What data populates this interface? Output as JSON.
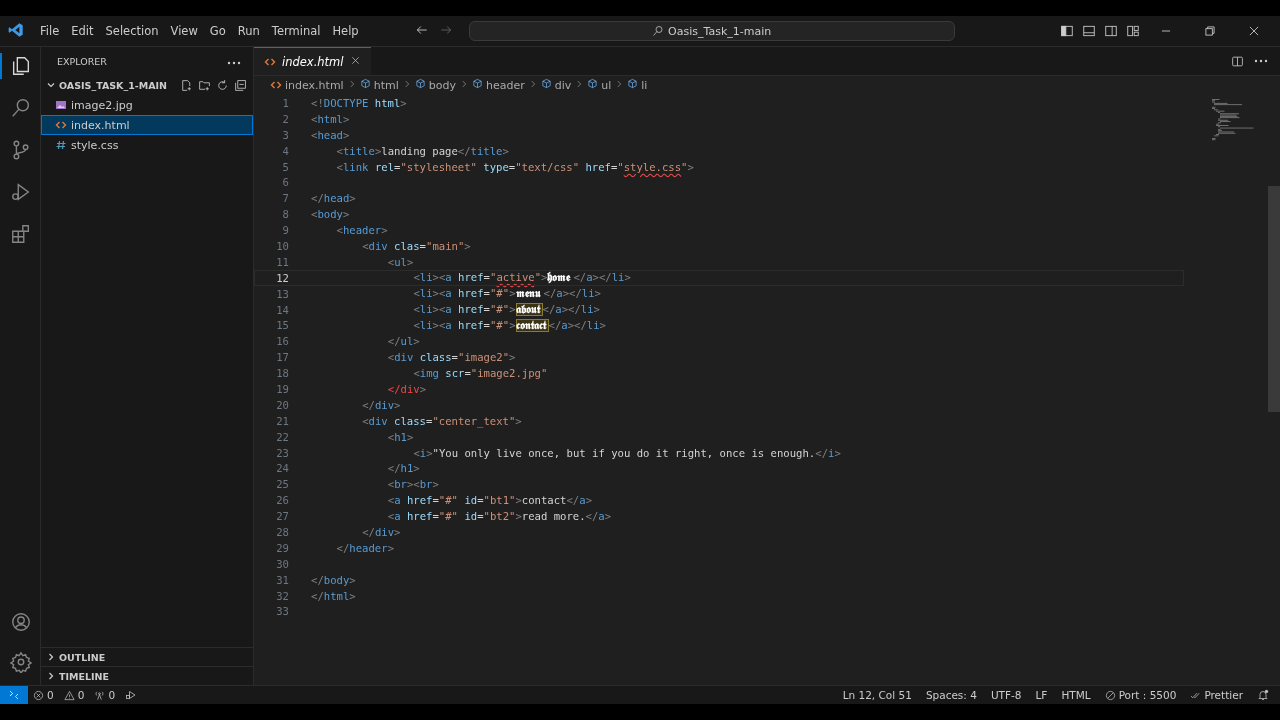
{
  "title_bar": {
    "menu": [
      "File",
      "Edit",
      "Selection",
      "View",
      "Go",
      "Run",
      "Terminal",
      "Help"
    ],
    "command_center": "Oasis_Task_1-main"
  },
  "activity_bar": {
    "items": [
      {
        "kind": "explorer",
        "selected": true
      },
      {
        "kind": "search",
        "selected": false
      },
      {
        "kind": "source-control",
        "selected": false
      },
      {
        "kind": "run-debug",
        "selected": false
      },
      {
        "kind": "extensions",
        "selected": false
      }
    ],
    "bottom": [
      {
        "kind": "account"
      },
      {
        "kind": "settings"
      }
    ]
  },
  "sidebar": {
    "title": "EXPLORER",
    "folder": {
      "name": "OASIS_TASK_1-MAIN",
      "expanded": true,
      "files": [
        {
          "name": "image2.jpg",
          "kind": "image",
          "selected": false
        },
        {
          "name": "index.html",
          "kind": "html",
          "selected": true
        },
        {
          "name": "style.css",
          "kind": "css",
          "selected": false
        }
      ]
    },
    "sections": [
      {
        "name": "OUTLINE",
        "expanded": false
      },
      {
        "name": "TIMELINE",
        "expanded": false
      }
    ]
  },
  "editor": {
    "tabs": [
      {
        "label": "index.html",
        "kind": "html",
        "selected": true
      }
    ],
    "breadcrumbs": [
      {
        "label": "index.html",
        "kind": "file"
      },
      {
        "label": "html",
        "kind": "element"
      },
      {
        "label": "body",
        "kind": "element"
      },
      {
        "label": "header",
        "kind": "element"
      },
      {
        "label": "div",
        "kind": "element"
      },
      {
        "label": "ul",
        "kind": "element"
      },
      {
        "label": "li",
        "kind": "element"
      }
    ],
    "lines": [
      {
        "number": "1",
        "current": false,
        "tokens": [
          {
            "kind": "punct",
            "text": "<!"
          },
          {
            "kind": "tag",
            "text": "DOCTYPE"
          },
          {
            "kind": "attr",
            "text": " html"
          },
          {
            "kind": "punct",
            "text": ">"
          }
        ]
      },
      {
        "number": "2",
        "current": false,
        "tokens": [
          {
            "kind": "punct",
            "text": "<"
          },
          {
            "kind": "tag",
            "text": "html"
          },
          {
            "kind": "punct",
            "text": ">"
          }
        ]
      },
      {
        "number": "3",
        "current": false,
        "tokens": [
          {
            "kind": "punct",
            "text": "<"
          },
          {
            "kind": "tag",
            "text": "head"
          },
          {
            "kind": "punct",
            "text": ">"
          }
        ],
        "children": [
          {
            "number": "4",
            "current": false,
            "tokens": [
              {
                "kind": "punct",
                "text": "<"
              },
              {
                "kind": "tag",
                "text": "title"
              },
              {
                "kind": "punct",
                "text": ">"
              },
              {
                "kind": "plain",
                "text": "landing page"
              },
              {
                "kind": "punct",
                "text": "</"
              },
              {
                "kind": "tag",
                "text": "title"
              },
              {
                "kind": "punct",
                "text": ">"
              }
            ]
          },
          {
            "number": "5",
            "current": false,
            "tokens": [
              {
                "kind": "punct",
                "text": "<"
              },
              {
                "kind": "tag",
                "text": "link"
              },
              {
                "kind": "attr",
                "text": " rel"
              },
              {
                "kind": "plain",
                "text": "="
              },
              {
                "kind": "str",
                "text": "\"stylesheet\""
              },
              {
                "kind": "attr",
                "text": " type"
              },
              {
                "kind": "plain",
                "text": "="
              },
              {
                "kind": "str",
                "text": "\"text/css\""
              },
              {
                "kind": "attr",
                "text": " href"
              },
              {
                "kind": "plain",
                "text": "="
              },
              {
                "kind": "str",
                "text": "\""
              },
              {
                "kind": "str",
                "text": "style.css",
                "squiggle": true
              },
              {
                "kind": "str",
                "text": "\""
              },
              {
                "kind": "punct",
                "text": ">"
              }
            ]
          },
          {
            "number": "6",
            "current": false
          }
        ]
      },
      {
        "number": "7",
        "current": false,
        "tokens": [
          {
            "kind": "punct",
            "text": "</"
          },
          {
            "kind": "tag",
            "text": "head"
          },
          {
            "kind": "punct",
            "text": ">"
          }
        ]
      },
      {
        "number": "8",
        "current": false,
        "tokens": [
          {
            "kind": "punct",
            "text": "<"
          },
          {
            "kind": "tag",
            "text": "body"
          },
          {
            "kind": "punct",
            "text": ">"
          }
        ],
        "children": [
          {
            "number": "9",
            "current": false,
            "tokens": [
              {
                "kind": "punct",
                "text": "<"
              },
              {
                "kind": "tag",
                "text": "header"
              },
              {
                "kind": "punct",
                "text": ">"
              }
            ],
            "children": [
              {
                "number": "10",
                "current": false,
                "tokens": [
                  {
                    "kind": "punct",
                    "text": "<"
                  },
                  {
                    "kind": "tag",
                    "text": "div"
                  },
                  {
                    "kind": "attr",
                    "text": " clas"
                  },
                  {
                    "kind": "plain",
                    "text": "="
                  },
                  {
                    "kind": "str",
                    "text": "\"main\""
                  },
                  {
                    "kind": "punct",
                    "text": ">"
                  }
                ],
                "children": [
                  {
                    "number": "11",
                    "current": false,
                    "tokens": [
                      {
                        "kind": "punct",
                        "text": "<"
                      },
                      {
                        "kind": "tag",
                        "text": "ul"
                      },
                      {
                        "kind": "punct",
                        "text": ">"
                      }
                    ],
                    "children": [
                      {
                        "number": "12",
                        "current": true,
                        "tokens": [
                          {
                            "kind": "punct",
                            "text": "<"
                          },
                          {
                            "kind": "tag",
                            "text": "li"
                          },
                          {
                            "kind": "punct",
                            "text": "><"
                          },
                          {
                            "kind": "tag",
                            "text": "a"
                          },
                          {
                            "kind": "attr",
                            "text": " href"
                          },
                          {
                            "kind": "plain",
                            "text": "="
                          },
                          {
                            "kind": "str",
                            "text": "\""
                          },
                          {
                            "kind": "str",
                            "text": "active",
                            "squiggle": true
                          },
                          {
                            "kind": "str",
                            "text": "\""
                          },
                          {
                            "kind": "punct",
                            "text": ">"
                          },
                          {
                            "kind": "fancy",
                            "text": "𝖍𝖔𝖒𝖊"
                          },
                          {
                            "kind": "punct",
                            "text": "</"
                          },
                          {
                            "kind": "tag",
                            "text": "a"
                          },
                          {
                            "kind": "punct",
                            "text": "></"
                          },
                          {
                            "kind": "tag",
                            "text": "li"
                          },
                          {
                            "kind": "punct",
                            "text": ">"
                          }
                        ]
                      },
                      {
                        "number": "13",
                        "current": false,
                        "tokens": [
                          {
                            "kind": "punct",
                            "text": "<"
                          },
                          {
                            "kind": "tag",
                            "text": "li"
                          },
                          {
                            "kind": "punct",
                            "text": "><"
                          },
                          {
                            "kind": "tag",
                            "text": "a"
                          },
                          {
                            "kind": "attr",
                            "text": " href"
                          },
                          {
                            "kind": "plain",
                            "text": "="
                          },
                          {
                            "kind": "str",
                            "text": "\"#\""
                          },
                          {
                            "kind": "punct",
                            "text": ">"
                          },
                          {
                            "kind": "fancy",
                            "text": "𝖒𝖊𝖓𝖚"
                          },
                          {
                            "kind": "punct",
                            "text": "</"
                          },
                          {
                            "kind": "tag",
                            "text": "a"
                          },
                          {
                            "kind": "punct",
                            "text": "></"
                          },
                          {
                            "kind": "tag",
                            "text": "li"
                          },
                          {
                            "kind": "punct",
                            "text": ">"
                          }
                        ]
                      },
                      {
                        "number": "14",
                        "current": false,
                        "tokens": [
                          {
                            "kind": "punct",
                            "text": "<"
                          },
                          {
                            "kind": "tag",
                            "text": "li"
                          },
                          {
                            "kind": "punct",
                            "text": "><"
                          },
                          {
                            "kind": "tag",
                            "text": "a"
                          },
                          {
                            "kind": "attr",
                            "text": " href"
                          },
                          {
                            "kind": "plain",
                            "text": "="
                          },
                          {
                            "kind": "str",
                            "text": "\"#\""
                          },
                          {
                            "kind": "punct",
                            "text": ">"
                          },
                          {
                            "kind": "fancy",
                            "text": "𝖆𝖇𝖔𝖚𝖙",
                            "highlighted": true
                          },
                          {
                            "kind": "punct",
                            "text": "</"
                          },
                          {
                            "kind": "tag",
                            "text": "a"
                          },
                          {
                            "kind": "punct",
                            "text": "></"
                          },
                          {
                            "kind": "tag",
                            "text": "li"
                          },
                          {
                            "kind": "punct",
                            "text": ">"
                          }
                        ]
                      },
                      {
                        "number": "15",
                        "current": false,
                        "tokens": [
                          {
                            "kind": "punct",
                            "text": "<"
                          },
                          {
                            "kind": "tag",
                            "text": "li"
                          },
                          {
                            "kind": "punct",
                            "text": "><"
                          },
                          {
                            "kind": "tag",
                            "text": "a"
                          },
                          {
                            "kind": "attr",
                            "text": " href"
                          },
                          {
                            "kind": "plain",
                            "text": "="
                          },
                          {
                            "kind": "str",
                            "text": "\"#\""
                          },
                          {
                            "kind": "punct",
                            "text": ">"
                          },
                          {
                            "kind": "fancy",
                            "text": "𝖈𝖔𝖓𝖙𝖆𝖈𝖙",
                            "highlighted": true
                          },
                          {
                            "kind": "punct",
                            "text": "</"
                          },
                          {
                            "kind": "tag",
                            "text": "a"
                          },
                          {
                            "kind": "punct",
                            "text": "></"
                          },
                          {
                            "kind": "tag",
                            "text": "li"
                          },
                          {
                            "kind": "punct",
                            "text": ">"
                          }
                        ]
                      }
                    ]
                  },
                  {
                    "number": "16",
                    "current": false,
                    "tokens": [
                      {
                        "kind": "punct",
                        "text": "</"
                      },
                      {
                        "kind": "tag",
                        "text": "ul"
                      },
                      {
                        "kind": "punct",
                        "text": ">"
                      }
                    ]
                  },
                  {
                    "number": "17",
                    "current": false,
                    "tokens": [
                      {
                        "kind": "punct",
                        "text": "<"
                      },
                      {
                        "kind": "tag",
                        "text": "div"
                      },
                      {
                        "kind": "attr",
                        "text": " class"
                      },
                      {
                        "kind": "plain",
                        "text": "="
                      },
                      {
                        "kind": "str",
                        "text": "\"image2\""
                      },
                      {
                        "kind": "punct",
                        "text": ">"
                      }
                    ],
                    "children": [
                      {
                        "number": "18",
                        "current": false,
                        "tokens": [
                          {
                            "kind": "punct",
                            "text": "<"
                          },
                          {
                            "kind": "tag",
                            "text": "img"
                          },
                          {
                            "kind": "attr",
                            "text": " scr"
                          },
                          {
                            "kind": "plain",
                            "text": "="
                          },
                          {
                            "kind": "str",
                            "text": "\"image2.jpg\""
                          }
                        ]
                      }
                    ]
                  },
                  {
                    "number": "19",
                    "current": false,
                    "tokens": [
                      {
                        "kind": "error",
                        "text": "</div"
                      },
                      {
                        "kind": "punct",
                        "text": ">"
                      }
                    ]
                  }
                ]
              },
              {
                "number": "20",
                "current": false,
                "tokens": [
                  {
                    "kind": "punct",
                    "text": "</"
                  },
                  {
                    "kind": "tag",
                    "text": "div"
                  },
                  {
                    "kind": "punct",
                    "text": ">"
                  }
                ]
              },
              {
                "number": "21",
                "current": false,
                "tokens": [
                  {
                    "kind": "punct",
                    "text": "<"
                  },
                  {
                    "kind": "tag",
                    "text": "div"
                  },
                  {
                    "kind": "attr",
                    "text": " class"
                  },
                  {
                    "kind": "plain",
                    "text": "="
                  },
                  {
                    "kind": "str",
                    "text": "\"center_text\""
                  },
                  {
                    "kind": "punct",
                    "text": ">"
                  }
                ],
                "children": [
                  {
                    "number": "22",
                    "current": false,
                    "tokens": [
                      {
                        "kind": "punct",
                        "text": "<"
                      },
                      {
                        "kind": "tag",
                        "text": "h1"
                      },
                      {
                        "kind": "punct",
                        "text": ">"
                      }
                    ],
                    "children": [
                      {
                        "number": "23",
                        "current": false,
                        "tokens": [
                          {
                            "kind": "punct",
                            "text": "<"
                          },
                          {
                            "kind": "tag",
                            "text": "i"
                          },
                          {
                            "kind": "punct",
                            "text": ">"
                          },
                          {
                            "kind": "plain",
                            "text": "\"You only live once, but if you do it right, once is enough."
                          },
                          {
                            "kind": "punct",
                            "text": "</"
                          },
                          {
                            "kind": "tag",
                            "text": "i"
                          },
                          {
                            "kind": "punct",
                            "text": ">"
                          }
                        ]
                      }
                    ]
                  },
                  {
                    "number": "24",
                    "current": false,
                    "tokens": [
                      {
                        "kind": "punct",
                        "text": "</"
                      },
                      {
                        "kind": "tag",
                        "text": "h1"
                      },
                      {
                        "kind": "punct",
                        "text": ">"
                      }
                    ]
                  },
                  {
                    "number": "25",
                    "current": false,
                    "tokens": [
                      {
                        "kind": "punct",
                        "text": "<"
                      },
                      {
                        "kind": "tag",
                        "text": "br"
                      },
                      {
                        "kind": "punct",
                        "text": "><"
                      },
                      {
                        "kind": "tag",
                        "text": "br"
                      },
                      {
                        "kind": "punct",
                        "text": ">"
                      }
                    ]
                  },
                  {
                    "number": "26",
                    "current": false,
                    "tokens": [
                      {
                        "kind": "punct",
                        "text": "<"
                      },
                      {
                        "kind": "tag",
                        "text": "a"
                      },
                      {
                        "kind": "attr",
                        "text": " href"
                      },
                      {
                        "kind": "plain",
                        "text": "="
                      },
                      {
                        "kind": "str",
                        "text": "\"#\""
                      },
                      {
                        "kind": "attr",
                        "text": " id"
                      },
                      {
                        "kind": "plain",
                        "text": "="
                      },
                      {
                        "kind": "str",
                        "text": "\"bt1\""
                      },
                      {
                        "kind": "punct",
                        "text": ">"
                      },
                      {
                        "kind": "plain",
                        "text": "contact"
                      },
                      {
                        "kind": "punct",
                        "text": "</"
                      },
                      {
                        "kind": "tag",
                        "text": "a"
                      },
                      {
                        "kind": "punct",
                        "text": ">"
                      }
                    ]
                  },
                  {
                    "number": "27",
                    "current": false,
                    "tokens": [
                      {
                        "kind": "punct",
                        "text": "<"
                      },
                      {
                        "kind": "tag",
                        "text": "a"
                      },
                      {
                        "kind": "attr",
                        "text": " href"
                      },
                      {
                        "kind": "plain",
                        "text": "="
                      },
                      {
                        "kind": "str",
                        "text": "\"#\""
                      },
                      {
                        "kind": "attr",
                        "text": " id"
                      },
                      {
                        "kind": "plain",
                        "text": "="
                      },
                      {
                        "kind": "str",
                        "text": "\"bt2\""
                      },
                      {
                        "kind": "punct",
                        "text": ">"
                      },
                      {
                        "kind": "plain",
                        "text": "read more."
                      },
                      {
                        "kind": "punct",
                        "text": "</"
                      },
                      {
                        "kind": "tag",
                        "text": "a"
                      },
                      {
                        "kind": "punct",
                        "text": ">"
                      }
                    ]
                  }
                ]
              },
              {
                "number": "28",
                "current": false,
                "tokens": [
                  {
                    "kind": "punct",
                    "text": "</"
                  },
                  {
                    "kind": "tag",
                    "text": "div"
                  },
                  {
                    "kind": "punct",
                    "text": ">"
                  }
                ]
              }
            ]
          },
          {
            "number": "29",
            "current": false,
            "tokens": [
              {
                "kind": "punct",
                "text": "</"
              },
              {
                "kind": "tag",
                "text": "header"
              },
              {
                "kind": "punct",
                "text": ">"
              }
            ]
          },
          {
            "number": "30",
            "current": false
          }
        ]
      },
      {
        "number": "31",
        "current": false,
        "tokens": [
          {
            "kind": "punct",
            "text": "</"
          },
          {
            "kind": "tag",
            "text": "body"
          },
          {
            "kind": "punct",
            "text": ">"
          }
        ]
      },
      {
        "number": "32",
        "current": false,
        "tokens": [
          {
            "kind": "punct",
            "text": "</"
          },
          {
            "kind": "tag",
            "text": "html"
          },
          {
            "kind": "punct",
            "text": ">"
          }
        ]
      },
      {
        "number": "33",
        "current": false
      }
    ]
  },
  "status_bar": {
    "left": [
      {
        "kind": "errors",
        "text": "0"
      },
      {
        "kind": "warnings",
        "text": "0"
      },
      {
        "kind": "ports",
        "text": "0"
      },
      {
        "kind": "run"
      }
    ],
    "right": [
      {
        "kind": "plain",
        "text": "Ln 12, Col 51"
      },
      {
        "kind": "plain",
        "text": "Spaces: 4"
      },
      {
        "kind": "plain",
        "text": "UTF-8"
      },
      {
        "kind": "plain",
        "text": "LF"
      },
      {
        "kind": "plain",
        "text": "HTML"
      },
      {
        "kind": "port",
        "text": "Port : 5500"
      },
      {
        "kind": "check",
        "text": "Prettier"
      },
      {
        "kind": "bell"
      }
    ]
  }
}
